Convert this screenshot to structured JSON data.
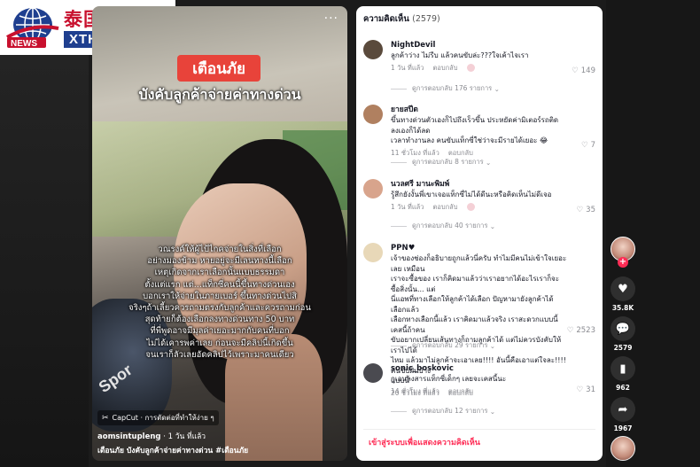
{
  "watermark": {
    "brand_cn": "泰国新闻网",
    "brand_en": "XTHAI.COM",
    "globe_label": "NEWS"
  },
  "video": {
    "badge": "เตือนภัย",
    "headline": "บังคับลูกค้าจ่ายค่าทางด่วน",
    "overlay_lines": [
      "วณรงค์ให้ผู้ไป้ไกคจ่ายในสิ่งที่เลือก",
      "อย่างมองข้าม หายอยู่จะมีเลนทางนี้เลือก",
      "เหตุเกิดจากเราเลือกนั้นแบบธรรมดา",
      "ตั้งแต่แรก แต่...แท็กซี่คนนี้ขึ้นทางด่วนเอง",
      "บอกเราให้จ่ายในภายเบอร์ ขึ้นทางด่วนไปสิ",
      "จริงๆถ้าเลี้ยวควรถามตรงกับลูกค้าและควรถามก่อน",
      "สุดท้ายก็ต้องเลือกลงทางด่วนทาง 50 บาท",
      "ที่พี่พูดอาจมีมุลค่าเยอะมากกับคนที่บอก",
      "ไม่ได้เคารพค่าเลย ก่อนจะมีคลิปนี้เกิดขึ้น",
      "จนเราก็ลัวเลยอัดคลิปไว้เพราะมาคนเดียว"
    ],
    "capcut_label": "CapCut · การตัดต่อที่ทำให้ง่าย ๆ",
    "author": "aomsintupleng",
    "posted": "· 1 วัน ที่แล้ว",
    "caption": "เตือนภัย บังคับลูกค้าจ่ายค่าทางด่วน #เตือนภัย",
    "glove_text": "Spor",
    "more": "···"
  },
  "comments_panel": {
    "title": "ความคิดเห็น",
    "count": "(2579)",
    "comments": [
      {
        "user": "NightDevil",
        "text": [
          "ลูกค้าว่าง ไม่รีบ แล้วคนขับล่ะ???ใจเค้าไจเรา"
        ],
        "time": "1 วัน ที่แล้ว",
        "reply": "ตอบกลับ",
        "likes": "149",
        "replies": "ดูการตอบกลับ 176 รายการ",
        "avatar_color": "#5a4a3c"
      },
      {
        "user": "ยายสปีด",
        "text": [
          "ขึ้นทางด่วนตัวเองก็ไปถึงเร็วขึ้น ประหยัดค่ามิเตอร์รถติด ลงเองก็ได้ลด",
          "เวลาทำงานลง คนขับแท็กซี่ใช่ว่าจะมีรายได้เยอะ 😂"
        ],
        "time": "11 ชั่วโมง ที่แล้ว",
        "reply": "ตอบกลับ",
        "likes": "7",
        "replies": "ดูการตอบกลับ 8 รายการ",
        "avatar_color": "#b08060"
      },
      {
        "user": "นวลศรี มานะพิมพ์",
        "text": [
          "รู้สึกยังงั้นพี่เขาเจอแท็กซี่ไม่ได้ดีนะหรือคิดเห็นไม่ดีเจอ"
        ],
        "time": "1 วัน ที่แล้ว",
        "reply": "ตอบกลับ",
        "likes": "35",
        "replies": "ดูการตอบกลับ 40 รายการ",
        "avatar_color": "#d8a48c"
      },
      {
        "user": "PPN♥",
        "text": [
          "เจ้าของช่องก็อธิบายถูกแล้วนี่ครับ ทำไมมีคนไม่เข้าใจเยอะเลย เหมือน",
          "เราจะซื้อของ เราก็คิดมาแล้วว่าเราอยากได้อะไรเราก็จะซื้อสิ่งนั้น... แต่",
          "นี่แอพที่ทางเลือกให้ลูกค้าได้เลือก ปัญหามายังลูกค้าได้เลือกแล้ว",
          "เลือกทางเลือกนี้แล้ว เราคิดมาแล้วจริง เราสะดวกแบบนี้ เคสนี้ถ้าคน",
          "ขับอยากเปลี่ยนเส้นทางก็ถามลูกค้าได้ แต่ไม่ควรบังคับให้เราไปได้",
          "ไหม แล้วมาไม่ลูกค้าจะเอาเลย!!!! อันนี้คือเอาแต่ใจละ!!!! คนขับฝั่นบ้าง",
          "แบบนี้"
        ],
        "time": "20 ชั่วโมง ที่แล้ว",
        "reply": "ตอบกลับ",
        "likes": "2523",
        "replies": "ดูการตอบกลับ 29 รายการ",
        "avatar_color": "#e8d8b8"
      },
      {
        "user": "sonic_boskovic",
        "text": [
          "กูเอนลงสารแท็กซี่เด็กๆ เลยจะเคสนี้นะ"
        ],
        "time": "14 ชั่วโมง ที่แล้ว",
        "reply": "ตอบกลับ",
        "likes": "31",
        "replies": "ดูการตอบกลับ 12 รายการ",
        "avatar_color": "#4a4a50"
      }
    ],
    "login_prompt": "เข้าสู่ระบบเพื่อแสดงความคิดเห็น"
  },
  "rail": {
    "likes": "35.8K",
    "comments": "2579",
    "saves": "962",
    "shares": "1967",
    "plus": "+"
  }
}
